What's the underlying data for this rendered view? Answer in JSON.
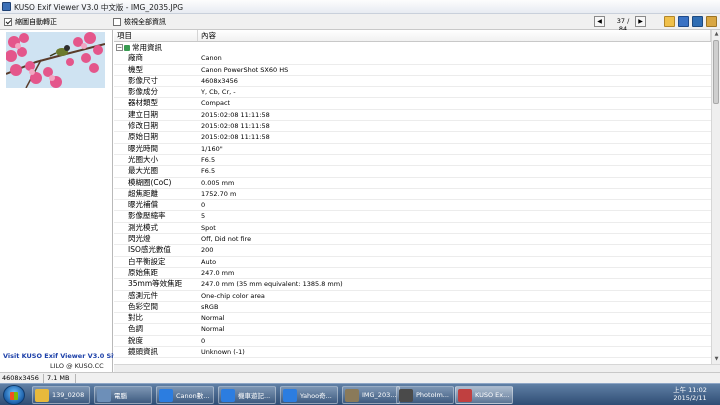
{
  "window": {
    "title": "KUSO Exif Viewer V3.0 中文版 - IMG_2035.JPG"
  },
  "toolbar": {
    "checkbox1_label": "縮圖自動轉正",
    "checkbox1_checked": true,
    "checkbox2_label": "檢視全部資訊",
    "checkbox2_checked": false,
    "page_counter": "37 / 84"
  },
  "left_panel": {
    "visit_text": "Visit KUSO Exif Viewer V3.0 Site",
    "lilo_text": "LILO @ KUSO.CC"
  },
  "table": {
    "headers": [
      "項目",
      "內容"
    ],
    "group_label": "常用資訊",
    "rows": [
      {
        "key": "廠商",
        "value": "Canon"
      },
      {
        "key": "機型",
        "value": "Canon PowerShot SX60 HS"
      },
      {
        "key": "影像尺寸",
        "value": "4608x3456"
      },
      {
        "key": "影像成分",
        "value": "Y, Cb, Cr, -"
      },
      {
        "key": "器材類型",
        "value": "Compact"
      },
      {
        "key": "建立日期",
        "value": "2015:02:08 11:11:58"
      },
      {
        "key": "修改日期",
        "value": "2015:02:08 11:11:58"
      },
      {
        "key": "原始日期",
        "value": "2015:02:08 11:11:58"
      },
      {
        "key": "曝光時間",
        "value": "1/160\""
      },
      {
        "key": "光圈大小",
        "value": "F6.5"
      },
      {
        "key": "最大光圈",
        "value": "F6.5"
      },
      {
        "key": "模糊圈(CoC)",
        "value": "0.005 mm"
      },
      {
        "key": "超焦距離",
        "value": "1752.70 m"
      },
      {
        "key": "曝光補償",
        "value": "0"
      },
      {
        "key": "影像壓縮率",
        "value": "5"
      },
      {
        "key": "測光模式",
        "value": "Spot"
      },
      {
        "key": "閃光燈",
        "value": "Off, Did not fire"
      },
      {
        "key": "ISO感光數值",
        "value": "200"
      },
      {
        "key": "白平衡設定",
        "value": "Auto"
      },
      {
        "key": "原始焦距",
        "value": "247.0 mm"
      },
      {
        "key": "35mm等效焦距",
        "value": "247.0 mm (35 mm equivalent: 1385.8 mm)"
      },
      {
        "key": "感測元件",
        "value": "One-chip color area"
      },
      {
        "key": "色彩空間",
        "value": "sRGB"
      },
      {
        "key": "對比",
        "value": "Normal"
      },
      {
        "key": "色調",
        "value": "Normal"
      },
      {
        "key": "銳度",
        "value": "0"
      },
      {
        "key": "鏡頭資訊",
        "value": "Unknown (-1)"
      }
    ]
  },
  "statusbar": {
    "dimensions": "4608x3456",
    "filesize": "7.1 MB"
  },
  "taskbar": {
    "buttons": [
      {
        "label": "139_0208",
        "icon": "folder-icon",
        "color": "#e8b93c"
      },
      {
        "label": "電腦",
        "icon": "computer-icon",
        "color": "#6d8fb8"
      },
      {
        "label": "Canon數...",
        "icon": "ie-icon",
        "color": "#2c7de0"
      },
      {
        "label": "機車遊記...",
        "icon": "ie-icon",
        "color": "#2c7de0"
      },
      {
        "label": "Yahoo奇...",
        "icon": "ie-icon",
        "color": "#2c7de0"
      },
      {
        "label": "IMG_203...",
        "icon": "image-icon",
        "color": "#8a7a5a"
      },
      {
        "label": "PhotoIm...",
        "icon": "photo-icon",
        "color": "#4a4a4a"
      },
      {
        "label": "KUSO Ex...",
        "icon": "kuso-icon",
        "color": "#c04040"
      }
    ],
    "clock_time": "上午 11:02",
    "clock_date": "2015/2/11"
  }
}
